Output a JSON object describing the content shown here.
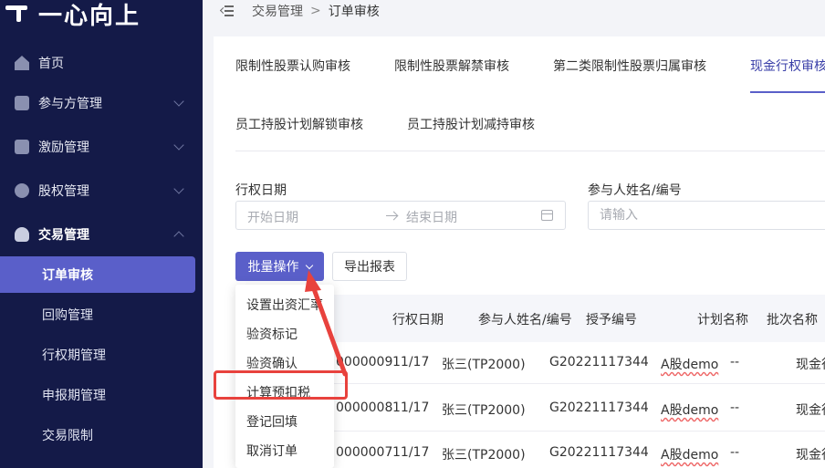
{
  "app": {
    "logo_text": "一心向上"
  },
  "sidebar": {
    "items": [
      {
        "label": "首页",
        "icon": "home-icon"
      },
      {
        "label": "参与方管理",
        "icon": "participant-icon"
      },
      {
        "label": "激励管理",
        "icon": "incentive-icon"
      },
      {
        "label": "股权管理",
        "icon": "equity-icon"
      },
      {
        "label": "交易管理",
        "icon": "trade-icon"
      }
    ],
    "sub_items": [
      "订单审核",
      "回购管理",
      "行权期管理",
      "申报期管理",
      "交易限制"
    ],
    "active_sub": "订单审核"
  },
  "breadcrumb": {
    "parent": "交易管理",
    "separator": ">",
    "current": "订单审核"
  },
  "tabs": [
    "限制性股票认购审核",
    "限制性股票解禁审核",
    "第二类限制性股票归属审核",
    "现金行权审核",
    "员工持股计划解锁审核",
    "员工持股计划减持审核"
  ],
  "filters": {
    "date_label": "行权日期",
    "start_placeholder": "开始日期",
    "end_placeholder": "结束日期",
    "name_label": "参与人姓名/编号",
    "name_placeholder": "请输入"
  },
  "buttons": {
    "batch": "批量操作",
    "export": "导出报表"
  },
  "table": {
    "headers": [
      "行权日期",
      "参与人姓名/编号",
      "授予编号",
      "计划名称",
      "批次名称"
    ],
    "rows": [
      {
        "order": "0000009",
        "date": "11/17",
        "person": "张三(TP2000)",
        "grant": "G20221117344",
        "plan": "A股demo",
        "dash": "--",
        "batch": "现金行"
      },
      {
        "order": "0000008",
        "date": "11/17",
        "person": "张三(TP2000)",
        "grant": "G20221117344",
        "plan": "A股demo",
        "dash": "--",
        "batch": "现金行"
      },
      {
        "order": "0000007",
        "date": "11/17",
        "person": "张三(TP2000)",
        "grant": "G20221117344",
        "plan": "A股demo",
        "dash": "--",
        "batch": "现金行"
      }
    ]
  },
  "dropdown": {
    "items": [
      "设置出资汇率",
      "验资标记",
      "验资确认",
      "计算预扣税",
      "登记回填",
      "取消订单"
    ],
    "highlighted": "计算预扣税"
  },
  "colors": {
    "sidebar_bg": "#141a48",
    "accent": "#5a5fc9",
    "annotation": "#e8423d"
  }
}
